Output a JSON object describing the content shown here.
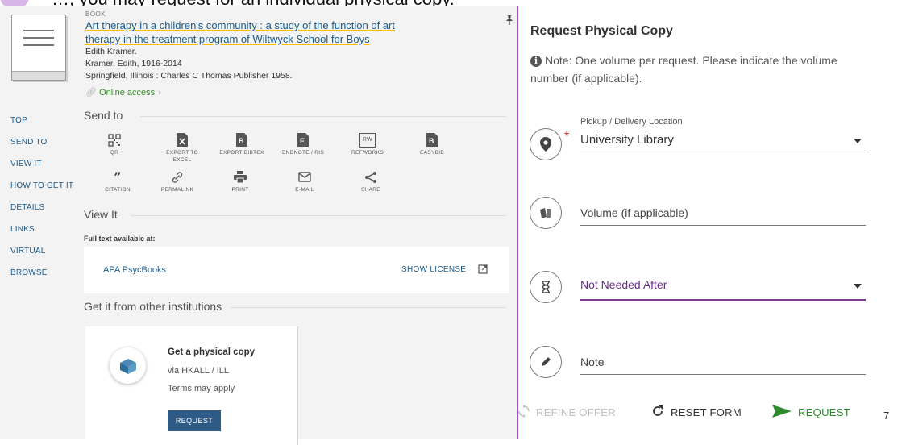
{
  "banner": {
    "text": "…, you may request for an individual physical copy."
  },
  "record": {
    "type": "BOOK",
    "title": "Art therapy in a children's community : a study of the function of art therapy in the treatment program of Wiltwyck School for Boys",
    "author": "Edith Kramer.",
    "author_dates": "Kramer, Edith, 1916-2014",
    "publisher": "Springfield, Illinois : Charles C Thomas Publisher 1958.",
    "online_access": "Online access"
  },
  "nav": {
    "items": [
      "TOP",
      "SEND TO",
      "VIEW IT",
      "HOW TO GET IT",
      "DETAILS",
      "LINKS",
      "VIRTUAL BROWSE"
    ]
  },
  "send_to": {
    "heading": "Send to",
    "actions": [
      {
        "label": "QR",
        "icon": "qr-code-icon"
      },
      {
        "label": "EXPORT TO EXCEL",
        "icon": "excel-icon"
      },
      {
        "label": "EXPORT BIBTEX",
        "icon": "bibtex-icon"
      },
      {
        "label": "ENDNOTE / RIS",
        "icon": "endnote-icon"
      },
      {
        "label": "REFWORKS",
        "icon": "refworks-icon"
      },
      {
        "label": "EASYBIB",
        "icon": "easybib-icon"
      },
      {
        "label": "CITATION",
        "icon": "quote-icon"
      },
      {
        "label": "PERMALINK",
        "icon": "link-icon"
      },
      {
        "label": "PRINT",
        "icon": "printer-icon"
      },
      {
        "label": "E-MAIL",
        "icon": "envelope-icon"
      },
      {
        "label": "SHARE",
        "icon": "share-icon"
      }
    ],
    "refworks_badge": "RW"
  },
  "view_it": {
    "heading": "View It",
    "fulltext_label": "Full text available at:",
    "provider": "APA PsycBooks",
    "show_license": "SHOW LICENSE"
  },
  "other_institutions": {
    "heading": "Get it from other institutions",
    "card_title": "Get a physical copy",
    "card_via": "via HKALL / ILL",
    "card_terms": "Terms may apply",
    "card_button": "REQUEST"
  },
  "request_form": {
    "title": "Request Physical Copy",
    "note": "Note: One volume per request. Please indicate the volume number (if applicable).",
    "pickup_label": "Pickup / Delivery Location",
    "pickup_value": "University Library",
    "volume_placeholder": "Volume (if applicable)",
    "not_needed_after": "Not Needed After",
    "note_placeholder": "Note",
    "refine_offer": "REFINE OFFER",
    "reset_form": "RESET FORM",
    "request": "REQUEST"
  },
  "page_number": "7",
  "colors": {
    "link_blue": "#1b5a8a",
    "online_green": "#3a8a2c",
    "highlight_yellow": "#f2c200",
    "panel_purple": "#a04fc0",
    "request_green": "#2e8b2e",
    "button_blue": "#2e5b86"
  }
}
